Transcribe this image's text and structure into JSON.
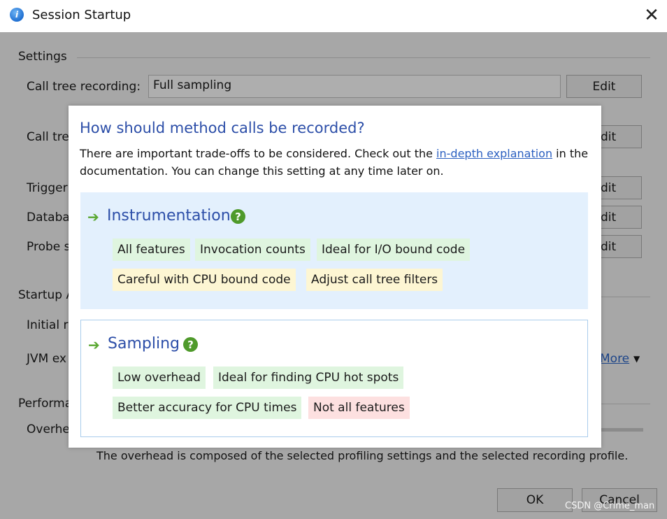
{
  "window": {
    "title": "Session Startup"
  },
  "background": {
    "settings_header": "Settings",
    "call_tree_recording_label": "Call tree recording:",
    "call_tree_recording_value": "Full sampling",
    "edit_label": "Edit",
    "call_tree_label_partial": "Call tre",
    "edit_partial": "dit",
    "trigger_label_partial": "Trigger",
    "database_label_partial": "Databa",
    "probe_label_partial": "Probe s",
    "startup_header_partial": "Startup A",
    "initial_label_partial": "Initial r",
    "jvm_label_partial": "JVM ex",
    "more_label": "More",
    "performance_header_partial": "Performa",
    "overhead_label_partial": "Overhe",
    "footer_note": "The overhead is composed of the selected profiling settings and the selected recording profile.",
    "ok_label": "OK",
    "cancel_label": "Cancel",
    "watermark": "CSDN @Crime_man"
  },
  "popup": {
    "title": "How should method calls be recorded?",
    "desc_before": "There are important trade-offs to be considered. Check out the ",
    "desc_link": "in-depth explanation",
    "desc_after": " in the documentation. You can change this setting at any time later on.",
    "options": [
      {
        "name": "Instrumentation",
        "chips": [
          {
            "label": "All features",
            "tone": "green"
          },
          {
            "label": "Invocation counts",
            "tone": "green"
          },
          {
            "label": "Ideal for I/O bound code",
            "tone": "green"
          },
          {
            "label": "Careful with CPU bound code",
            "tone": "yellow"
          },
          {
            "label": "Adjust call tree filters",
            "tone": "yellow"
          }
        ]
      },
      {
        "name": "Sampling",
        "chips": [
          {
            "label": "Low overhead",
            "tone": "green"
          },
          {
            "label": "Ideal for finding CPU hot spots",
            "tone": "green"
          },
          {
            "label": "Better accuracy for CPU times",
            "tone": "green"
          },
          {
            "label": "Not all features",
            "tone": "red"
          }
        ]
      }
    ]
  },
  "colors": {
    "title_blue": "#2c4ea8",
    "link_blue": "#2a5fc0",
    "chip_green": "#dff5df",
    "chip_yellow": "#fdf6d3",
    "chip_red": "#fde0e0",
    "arrow_green": "#5aa832",
    "selected_option_bg": "#e3f0fd"
  },
  "icons": {
    "app": "session-startup-app-icon",
    "close": "close-icon",
    "arrow": "right-arrow-icon",
    "help": "question-help-icon",
    "dropdown": "chevron-down-icon"
  }
}
